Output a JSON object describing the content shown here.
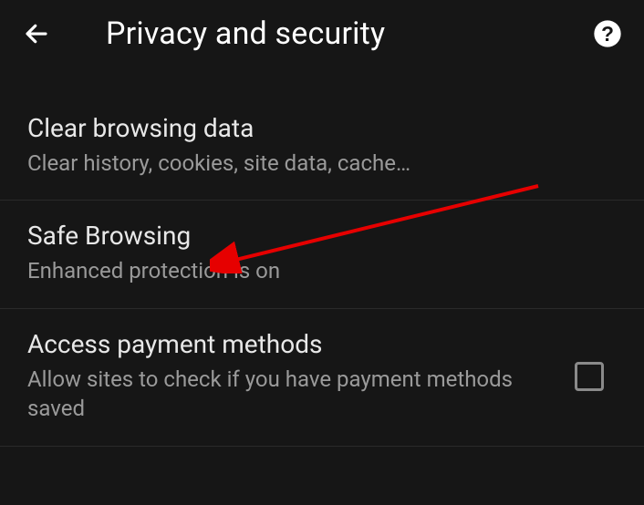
{
  "header": {
    "title": "Privacy and security"
  },
  "items": [
    {
      "title": "Clear browsing data",
      "subtitle": "Clear history, cookies, site data, cache…"
    },
    {
      "title": "Safe Browsing",
      "subtitle": "Enhanced protection is on"
    },
    {
      "title": "Access payment methods",
      "subtitle": "Allow sites to check if you have payment methods saved"
    }
  ]
}
